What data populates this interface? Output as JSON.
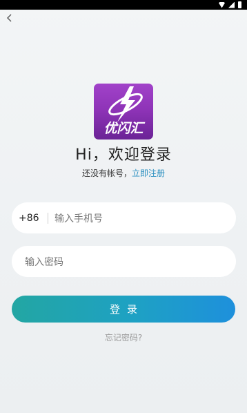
{
  "status_bar": {
    "icons": [
      "wifi-icon",
      "signal-icon",
      "battery-icon"
    ]
  },
  "nav": {
    "back_icon": "chevron-left-icon"
  },
  "logo": {
    "text": "优闪汇",
    "icon": "lightning-planet-icon",
    "colors": {
      "top": "#a142c9",
      "bottom": "#6b2396"
    }
  },
  "greeting": "Hi，欢迎登录",
  "register": {
    "prompt": "还没有帐号，",
    "link": "立即注册"
  },
  "phone_field": {
    "country_code": "+86",
    "placeholder": "输入手机号"
  },
  "password_field": {
    "placeholder": "输入密码"
  },
  "login_button": {
    "label": "登录",
    "colors": {
      "start": "#23a6a3",
      "end": "#1e90dc"
    }
  },
  "forgot_password": "忘记密码?"
}
